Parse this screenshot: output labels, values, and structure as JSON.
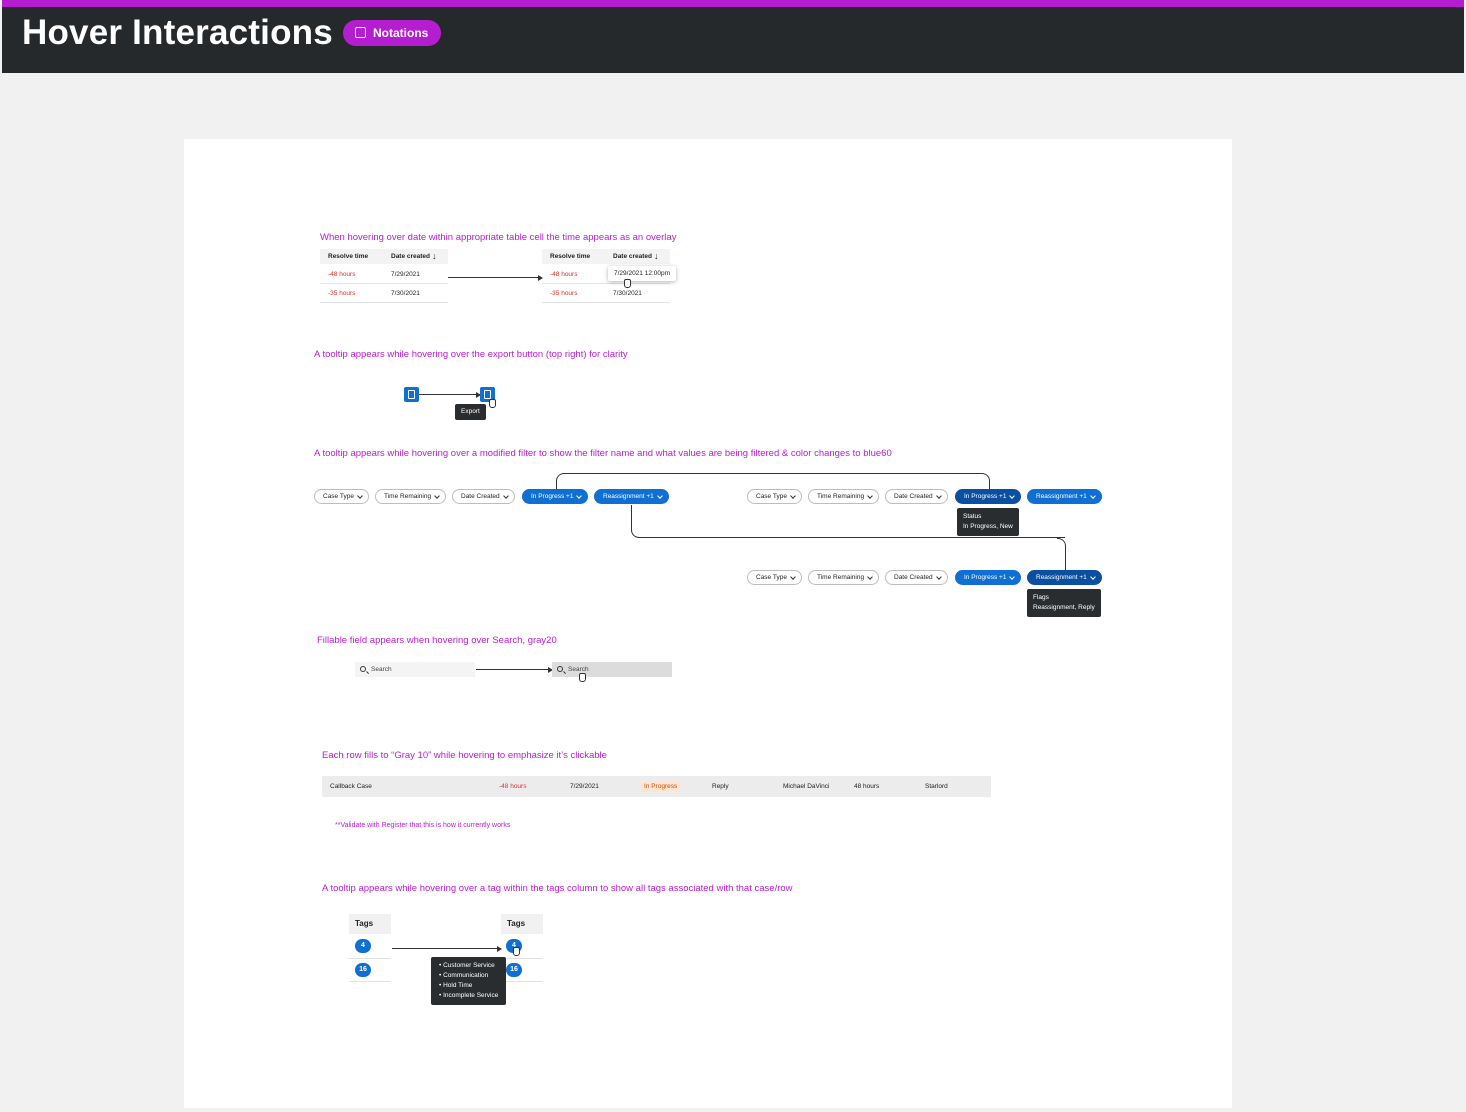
{
  "header": {
    "title": "Hover Interactions",
    "badge_label": "Notations",
    "accent": "#b51ed0"
  },
  "section1": {
    "note": "When hovering over date within appropriate table cell the time appears as an overlay",
    "col_resolve": "Resolve time",
    "col_date": "Date created",
    "rows": [
      {
        "resolve": "-48 hours",
        "date": "7/29/2021"
      },
      {
        "resolve": "-35 hours",
        "date": "7/30/2021"
      }
    ],
    "overlay": "7/29/2021 12:00pm"
  },
  "section2": {
    "note": "A tooltip appears while hovering over the export button (top right) for clarity",
    "tooltip": "Export"
  },
  "section3": {
    "note": "A tooltip appears while hovering over a modified filter to show the filter name and what values are being filtered & color changes to blue60",
    "filters": [
      "Case Type",
      "Time Remaining",
      "Date Created",
      "In Progress +1",
      "Reassignment +1"
    ],
    "tooltip_status_title": "Status",
    "tooltip_status_values": "In Progress, New",
    "tooltip_flags_title": "Flags",
    "tooltip_flags_values": "Reassignment, Reply"
  },
  "section4": {
    "note": "Fillable field appears when hovering over Search, gray20",
    "placeholder": "Search"
  },
  "section5": {
    "note": "Each row fills to “Gray 10” while hovering to emphasize it’s clickable",
    "row": {
      "case": "Callback Case",
      "resolve": "-48 hours",
      "date": "7/29/2021",
      "status": "In Progress",
      "type": "Reply",
      "owner": "Michael DaVinci",
      "sla": "48 hours",
      "assignee": "Starlord"
    },
    "footnote": "**Validate with Register that this is how it currently works"
  },
  "section6": {
    "note": "A tooltip appears while hovering over a tag within the tags column to show all tags associated with that case/row",
    "col": "Tags",
    "counts": [
      "4",
      "16"
    ],
    "tooltip_items": [
      "Customer Service",
      "Communication",
      "Hold Time",
      "Incomplete Service"
    ]
  }
}
